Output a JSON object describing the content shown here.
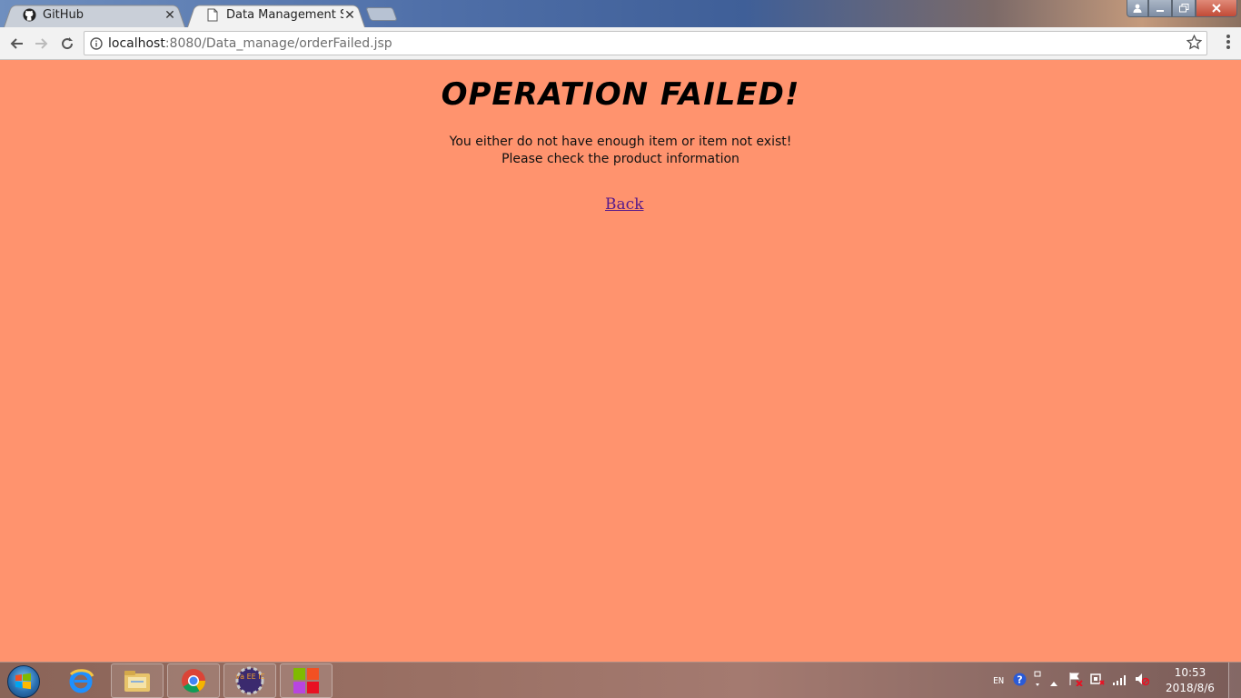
{
  "browser": {
    "tabs": [
      {
        "label": "GitHub",
        "icon": "github-icon",
        "active": false
      },
      {
        "label": "Data Management Syst",
        "icon": "page-icon",
        "active": true
      }
    ],
    "address": {
      "host": "localhost",
      "rest": ":8080/Data_manage/orderFailed.jsp"
    }
  },
  "page": {
    "heading": "Operation failed!",
    "message_line1": "You either do not have enough item or item not exist!",
    "message_line2": "Please check the product information",
    "back_link": "Back"
  },
  "taskbar": {
    "pinned": [
      "internet-explorer-icon",
      "file-explorer-icon",
      "chrome-icon",
      "java-ee-ide-icon",
      "tiles-app-icon"
    ],
    "java_label": "Java EE IDE",
    "tray_lang": "EN",
    "time": "10:53",
    "date": "2018/8/6"
  },
  "colors": {
    "page_background": "#ff936e",
    "link": "#551a8b"
  }
}
